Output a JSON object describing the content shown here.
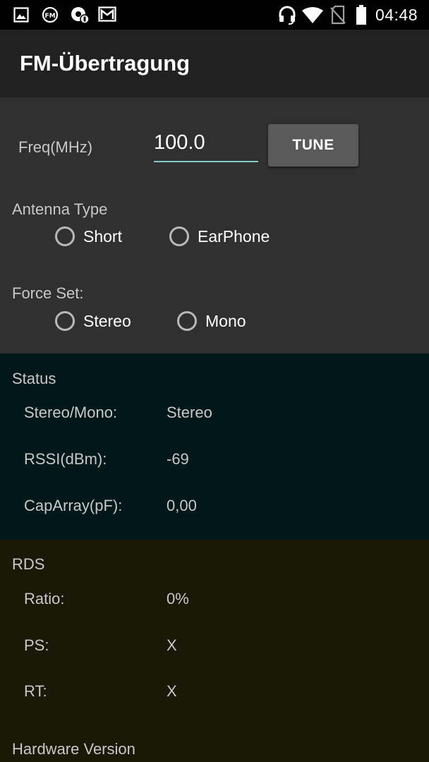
{
  "status_bar": {
    "time": "04:48",
    "left_icons": [
      "image-icon",
      "fm-radio-icon",
      "settings-badge-icon",
      "gmail-icon"
    ],
    "right_icons": [
      "headset-icon",
      "wifi-icon",
      "no-sim-icon",
      "battery-icon"
    ]
  },
  "app_bar": {
    "title": "FM-Übertragung"
  },
  "settings": {
    "freq_label": "Freq(MHz)",
    "freq_value": "100.0",
    "tune_button": "TUNE",
    "antenna_label": "Antenna Type",
    "antenna_options": [
      "Short",
      "EarPhone"
    ],
    "force_label": "Force Set:",
    "force_options": [
      "Stereo",
      "Mono"
    ]
  },
  "status": {
    "title": "Status",
    "rows": [
      {
        "key": "Stereo/Mono:",
        "value": "Stereo"
      },
      {
        "key": "RSSI(dBm):",
        "value": "-69"
      },
      {
        "key": "CapArray(pF):",
        "value": "0,00"
      }
    ]
  },
  "rds": {
    "title": "RDS",
    "rows": [
      {
        "key": "Ratio:",
        "value": "0%"
      },
      {
        "key": "PS:",
        "value": "X"
      },
      {
        "key": "RT:",
        "value": "X"
      }
    ]
  },
  "hardware": {
    "title": "Hardware Version"
  },
  "colors": {
    "accent": "#80cbc4",
    "status_bg": "#01181b",
    "rds_bg": "#1a1908",
    "settings_bg": "#303030",
    "appbar_bg": "#212121"
  }
}
